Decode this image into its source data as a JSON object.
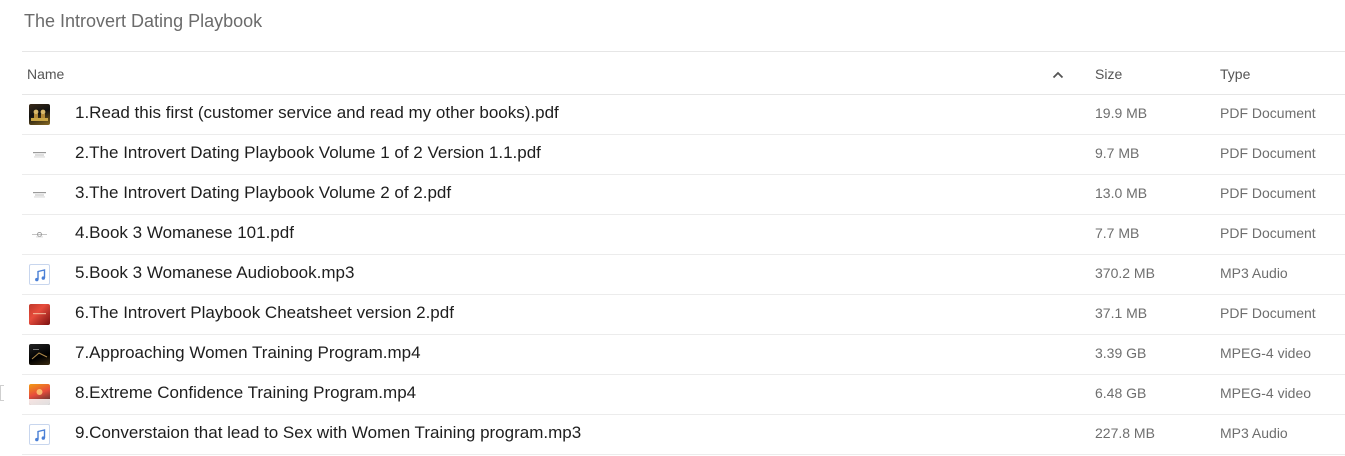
{
  "folder": {
    "title": "The Introvert Dating Playbook"
  },
  "columns": {
    "name": "Name",
    "size": "Size",
    "type": "Type",
    "sort_icon": "chevron-up-icon"
  },
  "files": [
    {
      "name": "1.Read this first (customer service and read my other books).pdf",
      "size": "19.9 MB",
      "type": "PDF Document",
      "thumb": "book-cover-thumbnail"
    },
    {
      "name": "2.The Introvert Dating Playbook Volume 1 of 2 Version 1.1.pdf",
      "size": "9.7 MB",
      "type": "PDF Document",
      "thumb": "pdf-page-thumbnail"
    },
    {
      "name": "3.The Introvert Dating Playbook Volume 2 of 2.pdf",
      "size": "13.0 MB",
      "type": "PDF Document",
      "thumb": "pdf-page-thumbnail"
    },
    {
      "name": "4.Book 3 Womanese 101.pdf",
      "size": "7.7 MB",
      "type": "PDF Document",
      "thumb": "pdf-page-thumbnail"
    },
    {
      "name": "5.Book 3 Womanese Audiobook.mp3",
      "size": "370.2 MB",
      "type": "MP3 Audio",
      "thumb": "music-note-icon"
    },
    {
      "name": "6.The Introvert Playbook Cheatsheet version 2.pdf",
      "size": "37.1 MB",
      "type": "PDF Document",
      "thumb": "cheatsheet-cover-thumbnail"
    },
    {
      "name": "7.Approaching Women Training Program.mp4",
      "size": "3.39 GB",
      "type": "MPEG-4 video",
      "thumb": "video-thumbnail"
    },
    {
      "name": "8.Extreme Confidence Training Program.mp4",
      "size": "6.48 GB",
      "type": "MPEG-4 video",
      "thumb": "video-thumbnail"
    },
    {
      "name": "9.Converstaion that lead to Sex with Women Training program.mp3",
      "size": "227.8 MB",
      "type": "MP3 Audio",
      "thumb": "music-note-icon"
    }
  ],
  "colors": {
    "title": "#6b6b6b",
    "text": "#1e1e1e",
    "muted": "#6e6e6e",
    "divider": "#e6e6e6",
    "audio_accent": "#4a7fd6"
  }
}
